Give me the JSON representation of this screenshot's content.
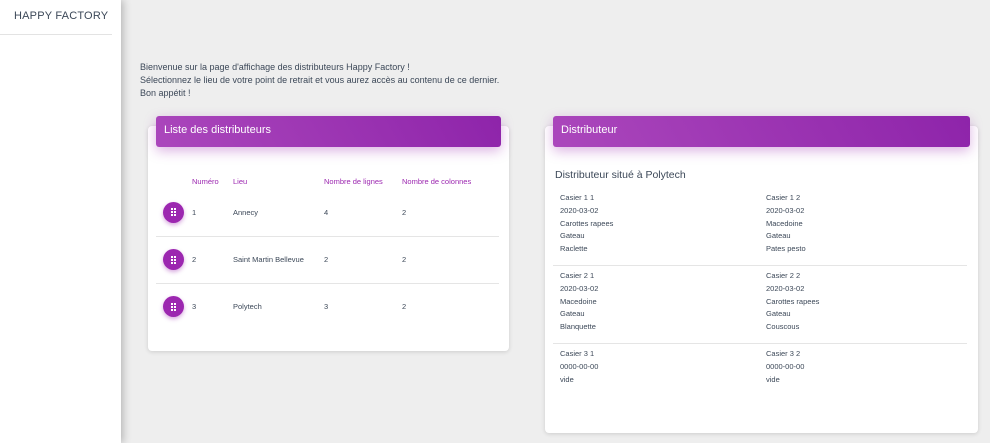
{
  "sidebar": {
    "brand": "HAPPY FACTORY"
  },
  "welcome": {
    "line1": "Bienvenue sur la page d'affichage des distributeurs Happy Factory !",
    "line2": "Sélectionnez le lieu de votre point de retrait et vous aurez accès au contenu de ce dernier.",
    "line3": "Bon appétit !"
  },
  "list_card": {
    "title": "Liste des distributeurs",
    "headers": {
      "numero": "Numéro",
      "lieu": "Lieu",
      "lignes": "Nombre de lignes",
      "colonnes": "Nombre de colonnes"
    },
    "rows": [
      {
        "numero": "1",
        "lieu": "Annecy",
        "lignes": "4",
        "colonnes": "2"
      },
      {
        "numero": "2",
        "lieu": "Saint Martin Bellevue",
        "lignes": "2",
        "colonnes": "2"
      },
      {
        "numero": "3",
        "lieu": "Polytech",
        "lignes": "3",
        "colonnes": "2"
      }
    ]
  },
  "detail_card": {
    "title": "Distributeur",
    "subtitle": "Distributeur situé à Polytech",
    "casiers": [
      [
        {
          "name": "Casier 1 1",
          "date": "2020-03-02",
          "lines": [
            "Carottes rapees",
            "Gateau",
            "Raclette"
          ]
        },
        {
          "name": "Casier 1 2",
          "date": "2020-03-02",
          "lines": [
            "Macedoine",
            "Gateau",
            "Pates pesto"
          ]
        }
      ],
      [
        {
          "name": "Casier 2 1",
          "date": "2020-03-02",
          "lines": [
            "Macedoine",
            "Gateau",
            "Blanquette"
          ]
        },
        {
          "name": "Casier 2 2",
          "date": "2020-03-02",
          "lines": [
            "Carottes rapees",
            "Gateau",
            "Couscous"
          ]
        }
      ],
      [
        {
          "name": "Casier 3 1",
          "date": "0000-00-00",
          "lines": [
            "vide"
          ]
        },
        {
          "name": "Casier 3 2",
          "date": "0000-00-00",
          "lines": [
            "vide"
          ]
        }
      ]
    ]
  },
  "colors": {
    "accent": "#9c27b0",
    "background": "#eeeeee"
  }
}
